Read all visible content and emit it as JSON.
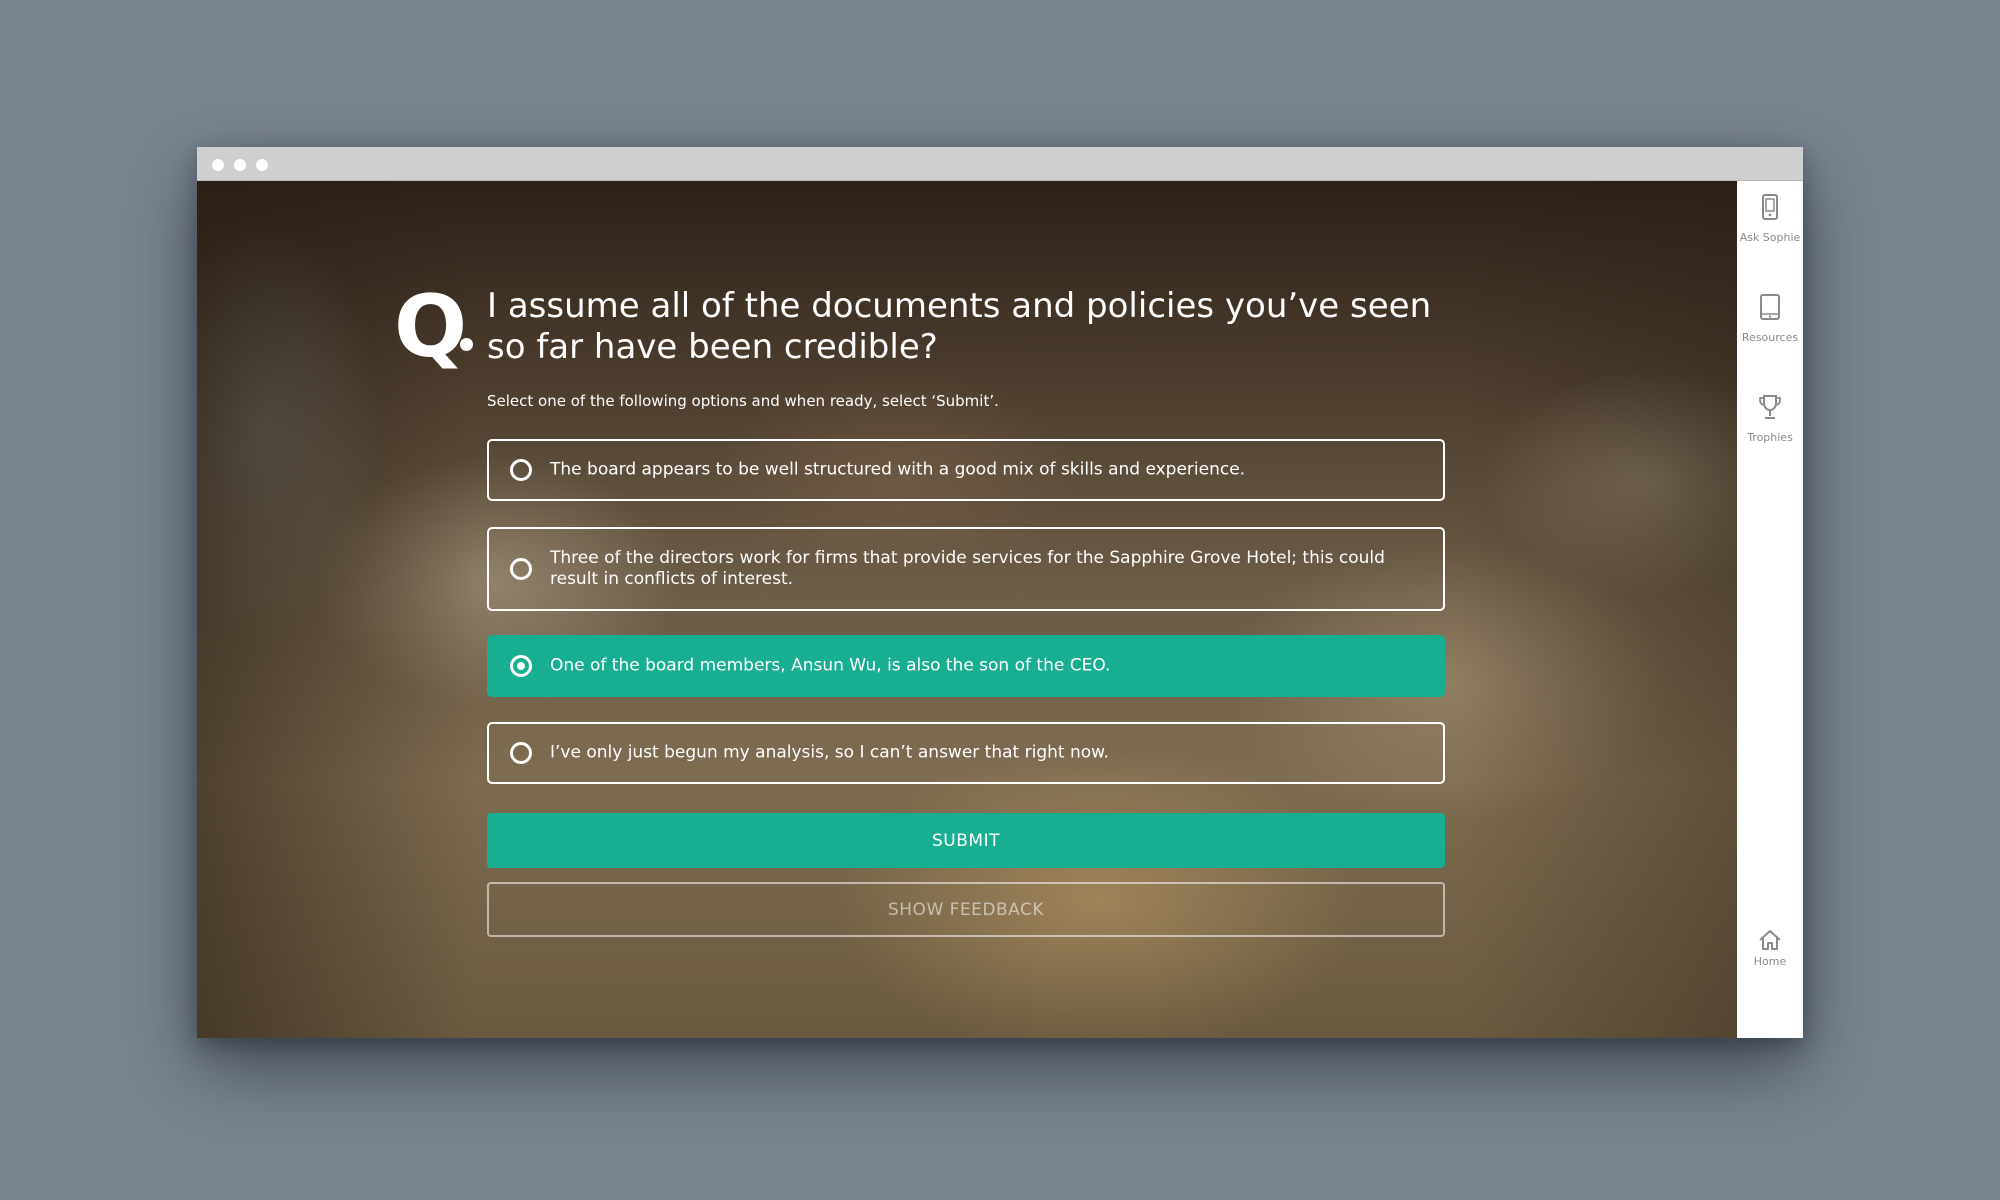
{
  "question": {
    "mark": "Q",
    "text": "I assume all of the documents and policies you’ve seen so far have been credible?",
    "instruction": "Select one of the following options and when ready, select ‘Submit’."
  },
  "options": [
    {
      "label": "The board appears to be well structured with a good mix of skills and experience.",
      "selected": false
    },
    {
      "label": "Three of the directors work for firms that provide services for the Sapphire Grove Hotel; this could result in conflicts of interest.",
      "selected": false
    },
    {
      "label": "One of the board members, Ansun Wu, is also the son of the CEO.",
      "selected": true
    },
    {
      "label": "I’ve only just begun my analysis, so I can’t answer that right now.",
      "selected": false
    }
  ],
  "buttons": {
    "submit": "SUBMIT",
    "feedback": "SHOW FEEDBACK"
  },
  "sidebar": {
    "items": [
      {
        "label": "Ask Sophie",
        "icon": "phone-icon"
      },
      {
        "label": "Resources",
        "icon": "tablet-icon"
      },
      {
        "label": "Trophies",
        "icon": "trophy-icon"
      },
      {
        "label": "Home",
        "icon": "home-icon"
      }
    ]
  },
  "colors": {
    "accent": "#17ae91",
    "sidebar_text": "#8a8a8a",
    "titlebar": "#cfcfcf",
    "backdrop": "#7a8591"
  }
}
